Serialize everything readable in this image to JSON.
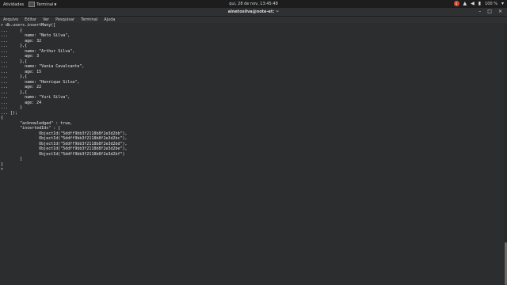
{
  "topbar": {
    "activities": "Atividades",
    "app_name": "Terminal",
    "clock": "qui, 28 de nov, 13:45:48",
    "battery": "100 %",
    "record_badge": "1"
  },
  "window": {
    "title": "alnetosilva@note-et: ~",
    "controls": [
      "–",
      "□",
      "×"
    ]
  },
  "menu": [
    "Arquivo",
    "Editar",
    "Ver",
    "Pesquisar",
    "Terminal",
    "Ajuda"
  ],
  "terminal_lines": [
    "> db.users.insertMany([",
    "...     {",
    "...       name: \"Neto Silva\",",
    "...       age: 32",
    "...     },{",
    "...       name: \"Arthur Silva\",",
    "...       age: 3",
    "...     },{",
    "...       name: \"Vania Cavalcante\",",
    "...       age: 15",
    "...     },{",
    "...       name: \"Henrique Silva\",",
    "...       age: 22",
    "...     },{",
    "...       name: \"Yuri Silva\",",
    "...       age: 24",
    "...     }",
    "... ]);",
    "{",
    "        \"acknowledged\" : true,",
    "        \"insertedIds\" : [",
    "                ObjectId(\"5ddff9bb3f2118b8f2e3d2bb\"),",
    "                ObjectId(\"5ddff9bb3f2118b8f2e3d2bc\"),",
    "                ObjectId(\"5ddff9bb3f2118b8f2e3d2bd\"),",
    "                ObjectId(\"5ddff9bb3f2118b8f2e3d2be\"),",
    "                ObjectId(\"5ddff9bb3f2118b8f2e3d2bf\")",
    "        ]",
    "}",
    ">"
  ],
  "colors": {
    "terminal_bg": "#2c2d2e",
    "terminal_fg": "#e6e6e6",
    "topbar_bg": "#1d1d1d"
  }
}
